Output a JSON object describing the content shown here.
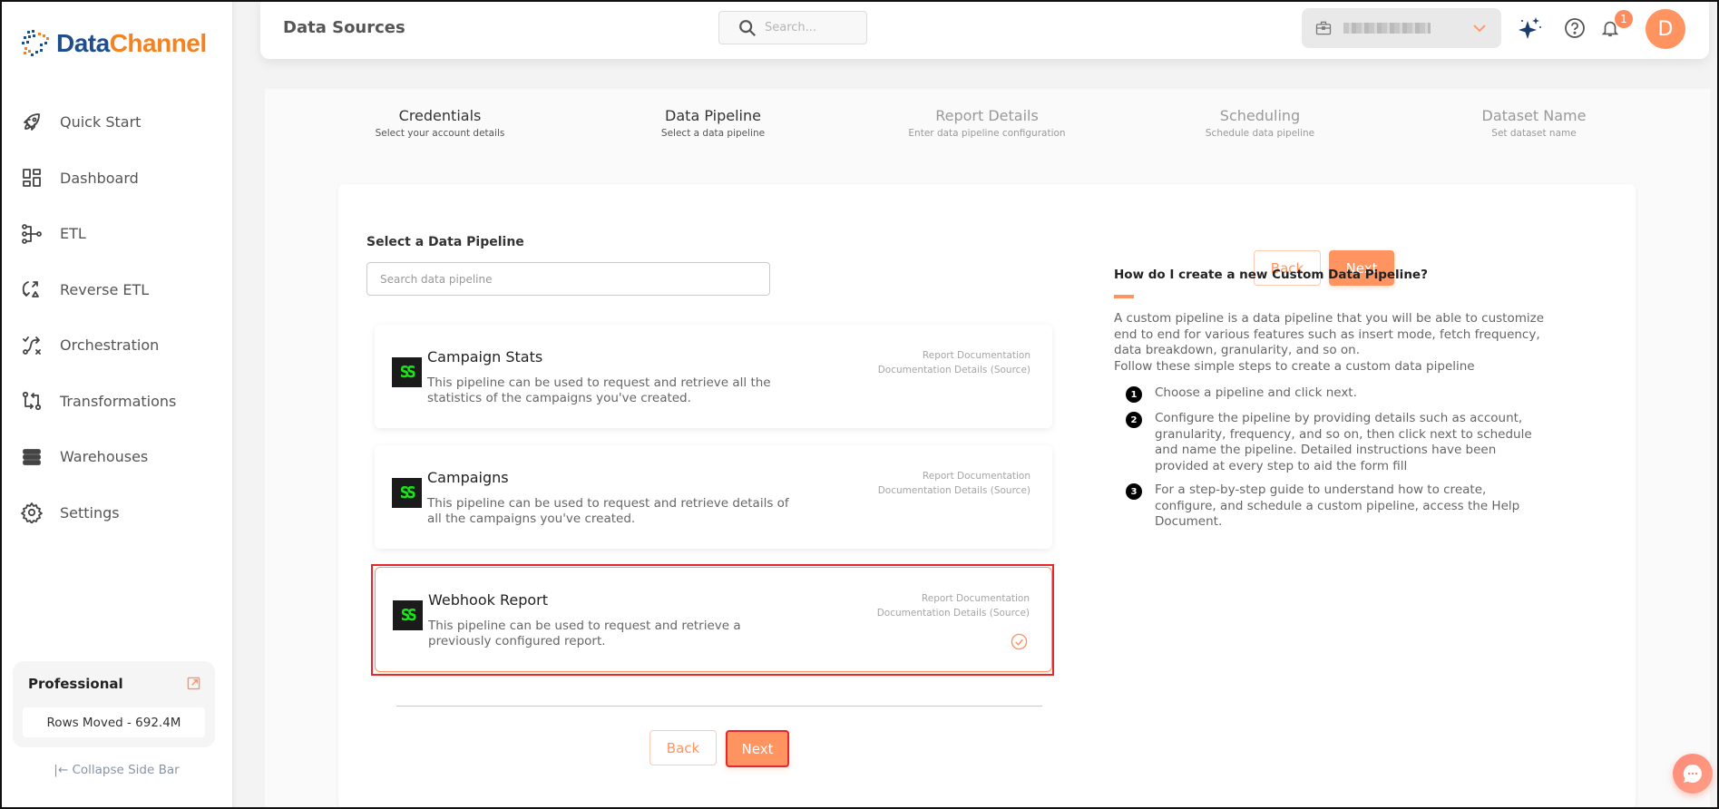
{
  "app": {
    "logo_part1": "Data",
    "logo_part2": "Channel",
    "brand_colors": {
      "primary_blue": "#1f4e8c",
      "primary_orange": "#f58220",
      "accent": "#ff9461"
    }
  },
  "sidebar": {
    "items": [
      {
        "label": "Quick Start",
        "icon": "rocket-icon"
      },
      {
        "label": "Dashboard",
        "icon": "dashboard-icon"
      },
      {
        "label": "ETL",
        "icon": "etl-icon"
      },
      {
        "label": "Reverse ETL",
        "icon": "reverse-etl-icon"
      },
      {
        "label": "Orchestration",
        "icon": "orchestration-icon"
      },
      {
        "label": "Transformations",
        "icon": "transformations-icon"
      },
      {
        "label": "Warehouses",
        "icon": "warehouses-icon"
      },
      {
        "label": "Settings",
        "icon": "gear-icon"
      }
    ],
    "plan": {
      "name": "Professional",
      "rows_moved": "Rows Moved - 692.4M"
    },
    "collapse_label": "|← Collapse Side Bar"
  },
  "header": {
    "title": "Data Sources",
    "search_placeholder": "Search...",
    "workspace_name": "Workspace 1 (blurred)",
    "notification_count": "1",
    "avatar_initial": "D"
  },
  "stepper": {
    "steps": [
      {
        "label": "Credentials",
        "sub": "Select your account details",
        "state": "done"
      },
      {
        "label": "Data Pipeline",
        "sub": "Select a data pipeline",
        "state": "done"
      },
      {
        "label": "Report Details",
        "sub": "Enter data pipeline configuration",
        "state": "pending"
      },
      {
        "label": "Scheduling",
        "sub": "Schedule data pipeline",
        "state": "pending"
      },
      {
        "label": "Dataset Name",
        "sub": "Set dataset name",
        "state": "pending"
      }
    ]
  },
  "main": {
    "section_title": "Select a Data Pipeline",
    "search_placeholder": "Search data pipeline",
    "back_label": "Back",
    "next_label": "Next",
    "pipelines": [
      {
        "name": "Campaign Stats",
        "description": "This pipeline can be used to request and retrieve all the statistics of the campaigns you've created.",
        "link1": "Report Documentation",
        "link2": "Documentation Details (Source)",
        "selected": false
      },
      {
        "name": "Campaigns",
        "description": "This pipeline can be used to request and retrieve details of all the campaigns you've created.",
        "link1": "Report Documentation",
        "link2": "Documentation Details (Source)",
        "selected": false
      },
      {
        "name": "Webhook Report",
        "description": "This pipeline can be used to request and retrieve a previously configured report.",
        "link1": "Report Documentation",
        "link2": "Documentation Details (Source)",
        "selected": true
      }
    ],
    "icon_glyph": "SS"
  },
  "help": {
    "title": "How do I create a new Custom Data Pipeline?",
    "intro": "A custom pipeline is a data pipeline that you will be able to customize end to end for various features such as insert mode, fetch frequency, data breakdown, granularity, and so on.",
    "intro2": "Follow these simple steps to create a custom data pipeline",
    "steps": [
      {
        "num": "1",
        "text": "Choose a pipeline and click next."
      },
      {
        "num": "2",
        "text": "Configure the pipeline by providing details such as account, granularity, frequency, and so on, then click next to schedule and name the pipeline. Detailed instructions have been provided at every step to aid the form fill"
      },
      {
        "num": "3",
        "text": "For a step-by-step guide to understand how to create, configure, and schedule a custom pipeline, access the Help Document."
      }
    ]
  }
}
